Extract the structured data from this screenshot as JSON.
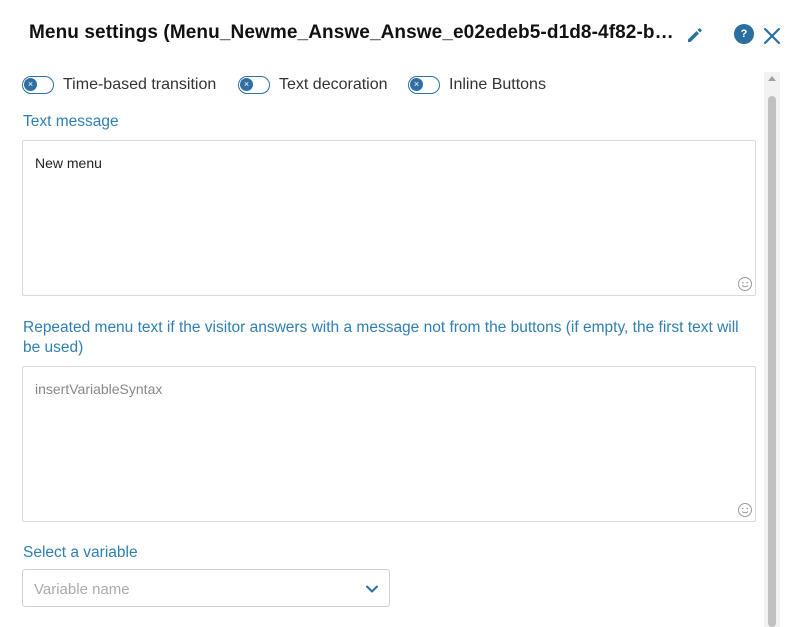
{
  "dialog": {
    "title": "Menu settings (Menu_Newme_Answe_Answe_e02edeb5-d1d8-4f82-b294-c...",
    "help_label": "?"
  },
  "toggles": [
    {
      "label": "Time-based transition",
      "state": "off"
    },
    {
      "label": "Text decoration",
      "state": "off"
    },
    {
      "label": "Inline Buttons",
      "state": "off"
    }
  ],
  "text_message": {
    "label": "Text message",
    "value": "New menu"
  },
  "repeated_text": {
    "label": "Repeated menu text if the visitor answers with a message not from the buttons (if empty, the first text will be used)",
    "placeholder": "insertVariableSyntax"
  },
  "variable": {
    "label": "Select a variable",
    "placeholder": "Variable name"
  },
  "colors": {
    "accent": "#2f7fb0",
    "toggle": "#2f6fa3"
  },
  "icons": [
    "edit-icon",
    "help-icon",
    "close-icon",
    "toggle-off-icon",
    "emoji-icon",
    "chevron-down-icon"
  ]
}
